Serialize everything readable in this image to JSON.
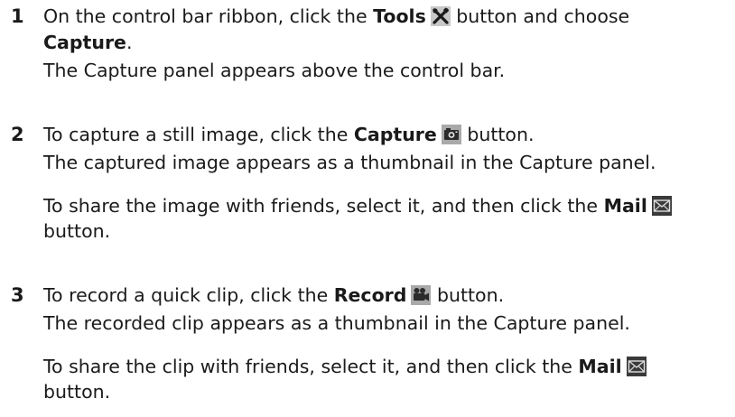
{
  "steps": [
    {
      "number": "1",
      "line1_pre": "On the control bar ribbon, click the ",
      "line1_bold": "Tools",
      "line1_post": " button and choose",
      "line2_bold": "Capture",
      "line2_post": ".",
      "line3": "The Capture panel appears above the control bar."
    },
    {
      "number": "2",
      "line1_pre": "To capture a still image, click the ",
      "line1_bold": "Capture",
      "line1_post": " button.",
      "line2": "The captured image appears as a thumbnail in the Capture panel.",
      "line3_pre": "To share the image with friends, select it, and then click the ",
      "line3_bold": "Mail",
      "line4": "button."
    },
    {
      "number": "3",
      "line1_pre": "To record a quick clip, click the ",
      "line1_bold": "Record",
      "line1_post": " button.",
      "line2": "The recorded clip appears as a thumbnail in the  Capture panel.",
      "line3_pre": "To share the clip with friends, select it, and then click the ",
      "line3_bold": "Mail",
      "line4": "button."
    }
  ],
  "icons": {
    "tools": "tools-icon",
    "capture": "camera-icon",
    "mail": "mail-icon",
    "record": "video-camera-icon"
  }
}
